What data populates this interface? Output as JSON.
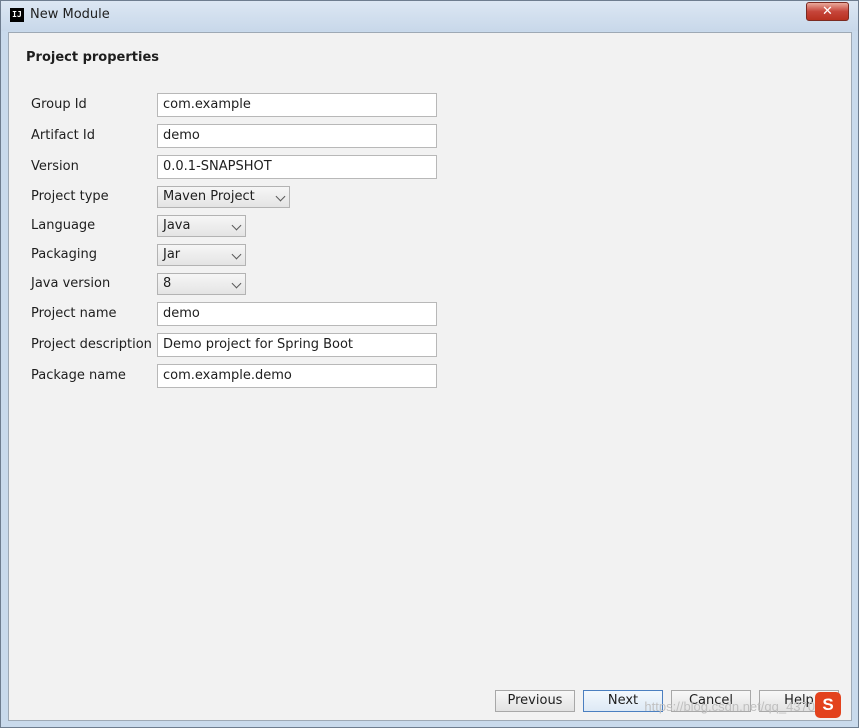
{
  "window": {
    "title": "New Module",
    "close_glyph": "✕",
    "app_icon_text": "IJ"
  },
  "section_title": "Project properties",
  "fields": {
    "group_id": {
      "label": "Group Id",
      "value": "com.example"
    },
    "artifact_id": {
      "label": "Artifact Id",
      "value": "demo"
    },
    "version": {
      "label": "Version",
      "value": "0.0.1-SNAPSHOT"
    },
    "project_type": {
      "label": "Project type",
      "value": "Maven Project"
    },
    "language": {
      "label": "Language",
      "value": "Java"
    },
    "packaging": {
      "label": "Packaging",
      "value": "Jar"
    },
    "java_version": {
      "label": "Java version",
      "value": "8"
    },
    "project_name": {
      "label": "Project name",
      "value": "demo"
    },
    "project_description": {
      "label": "Project description",
      "value": "Demo project for Spring Boot"
    },
    "package_name": {
      "label": "Package name",
      "value": "com.example.demo"
    }
  },
  "buttons": {
    "previous": "Previous",
    "next": "Next",
    "cancel": "Cancel",
    "help": "Help"
  },
  "watermark": "https://blog.csdn.net/qq_4370",
  "logo_letter": "S",
  "colors": {
    "titlebar": "#c8d8ea",
    "close_button": "#c6453a",
    "dialog_background": "#f2f2f2",
    "default_button_border": "#4b7fc0",
    "logo": "#e3421d"
  },
  "icons": {
    "app": "intellij-app-icon",
    "close": "close-icon",
    "dropdown": "chevron-down-icon",
    "logo": "sogou-logo-icon"
  }
}
